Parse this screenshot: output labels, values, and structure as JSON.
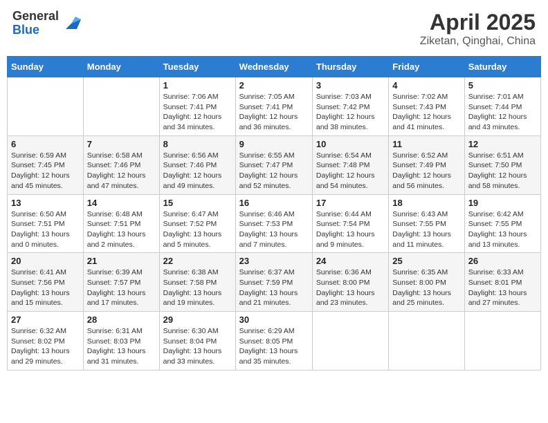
{
  "header": {
    "logo_general": "General",
    "logo_blue": "Blue",
    "month_title": "April 2025",
    "location": "Ziketan, Qinghai, China"
  },
  "weekdays": [
    "Sunday",
    "Monday",
    "Tuesday",
    "Wednesday",
    "Thursday",
    "Friday",
    "Saturday"
  ],
  "weeks": [
    [
      {
        "day": "",
        "info": ""
      },
      {
        "day": "",
        "info": ""
      },
      {
        "day": "1",
        "info": "Sunrise: 7:06 AM\nSunset: 7:41 PM\nDaylight: 12 hours and 34 minutes."
      },
      {
        "day": "2",
        "info": "Sunrise: 7:05 AM\nSunset: 7:41 PM\nDaylight: 12 hours and 36 minutes."
      },
      {
        "day": "3",
        "info": "Sunrise: 7:03 AM\nSunset: 7:42 PM\nDaylight: 12 hours and 38 minutes."
      },
      {
        "day": "4",
        "info": "Sunrise: 7:02 AM\nSunset: 7:43 PM\nDaylight: 12 hours and 41 minutes."
      },
      {
        "day": "5",
        "info": "Sunrise: 7:01 AM\nSunset: 7:44 PM\nDaylight: 12 hours and 43 minutes."
      }
    ],
    [
      {
        "day": "6",
        "info": "Sunrise: 6:59 AM\nSunset: 7:45 PM\nDaylight: 12 hours and 45 minutes."
      },
      {
        "day": "7",
        "info": "Sunrise: 6:58 AM\nSunset: 7:46 PM\nDaylight: 12 hours and 47 minutes."
      },
      {
        "day": "8",
        "info": "Sunrise: 6:56 AM\nSunset: 7:46 PM\nDaylight: 12 hours and 49 minutes."
      },
      {
        "day": "9",
        "info": "Sunrise: 6:55 AM\nSunset: 7:47 PM\nDaylight: 12 hours and 52 minutes."
      },
      {
        "day": "10",
        "info": "Sunrise: 6:54 AM\nSunset: 7:48 PM\nDaylight: 12 hours and 54 minutes."
      },
      {
        "day": "11",
        "info": "Sunrise: 6:52 AM\nSunset: 7:49 PM\nDaylight: 12 hours and 56 minutes."
      },
      {
        "day": "12",
        "info": "Sunrise: 6:51 AM\nSunset: 7:50 PM\nDaylight: 12 hours and 58 minutes."
      }
    ],
    [
      {
        "day": "13",
        "info": "Sunrise: 6:50 AM\nSunset: 7:51 PM\nDaylight: 13 hours and 0 minutes."
      },
      {
        "day": "14",
        "info": "Sunrise: 6:48 AM\nSunset: 7:51 PM\nDaylight: 13 hours and 2 minutes."
      },
      {
        "day": "15",
        "info": "Sunrise: 6:47 AM\nSunset: 7:52 PM\nDaylight: 13 hours and 5 minutes."
      },
      {
        "day": "16",
        "info": "Sunrise: 6:46 AM\nSunset: 7:53 PM\nDaylight: 13 hours and 7 minutes."
      },
      {
        "day": "17",
        "info": "Sunrise: 6:44 AM\nSunset: 7:54 PM\nDaylight: 13 hours and 9 minutes."
      },
      {
        "day": "18",
        "info": "Sunrise: 6:43 AM\nSunset: 7:55 PM\nDaylight: 13 hours and 11 minutes."
      },
      {
        "day": "19",
        "info": "Sunrise: 6:42 AM\nSunset: 7:55 PM\nDaylight: 13 hours and 13 minutes."
      }
    ],
    [
      {
        "day": "20",
        "info": "Sunrise: 6:41 AM\nSunset: 7:56 PM\nDaylight: 13 hours and 15 minutes."
      },
      {
        "day": "21",
        "info": "Sunrise: 6:39 AM\nSunset: 7:57 PM\nDaylight: 13 hours and 17 minutes."
      },
      {
        "day": "22",
        "info": "Sunrise: 6:38 AM\nSunset: 7:58 PM\nDaylight: 13 hours and 19 minutes."
      },
      {
        "day": "23",
        "info": "Sunrise: 6:37 AM\nSunset: 7:59 PM\nDaylight: 13 hours and 21 minutes."
      },
      {
        "day": "24",
        "info": "Sunrise: 6:36 AM\nSunset: 8:00 PM\nDaylight: 13 hours and 23 minutes."
      },
      {
        "day": "25",
        "info": "Sunrise: 6:35 AM\nSunset: 8:00 PM\nDaylight: 13 hours and 25 minutes."
      },
      {
        "day": "26",
        "info": "Sunrise: 6:33 AM\nSunset: 8:01 PM\nDaylight: 13 hours and 27 minutes."
      }
    ],
    [
      {
        "day": "27",
        "info": "Sunrise: 6:32 AM\nSunset: 8:02 PM\nDaylight: 13 hours and 29 minutes."
      },
      {
        "day": "28",
        "info": "Sunrise: 6:31 AM\nSunset: 8:03 PM\nDaylight: 13 hours and 31 minutes."
      },
      {
        "day": "29",
        "info": "Sunrise: 6:30 AM\nSunset: 8:04 PM\nDaylight: 13 hours and 33 minutes."
      },
      {
        "day": "30",
        "info": "Sunrise: 6:29 AM\nSunset: 8:05 PM\nDaylight: 13 hours and 35 minutes."
      },
      {
        "day": "",
        "info": ""
      },
      {
        "day": "",
        "info": ""
      },
      {
        "day": "",
        "info": ""
      }
    ]
  ]
}
